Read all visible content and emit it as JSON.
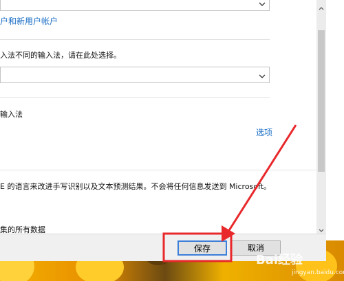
{
  "settings": {
    "link_account_text": "户和新用户帐户",
    "input_method_prompt": "入法不同的输入法，请在此处选择。",
    "input_method_heading": "输入法",
    "options_link": "选项",
    "handwriting_text": "E 的语言来改进手写识别以及文本预测结果。不会将任何信息发送到 Microsoft。",
    "collected_data_text": "集的所有数据"
  },
  "buttons": {
    "save_label": "保存",
    "cancel_label": "取消"
  },
  "watermark": {
    "brand": "Bai经验",
    "site": "jingyan.baidu.com"
  },
  "colors": {
    "link": "#1a6ec6",
    "annotation_red": "#e8282b",
    "save_border": "#3c7fd9"
  }
}
